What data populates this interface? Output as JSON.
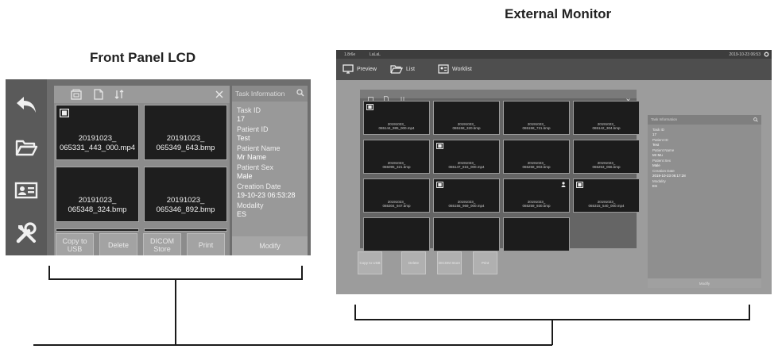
{
  "captions": {
    "front_panel": "Front Panel LCD",
    "external_monitor": "External Monitor"
  },
  "lcd": {
    "sidebar_icons": [
      "back-arrow-icon",
      "folder-icon",
      "contact-card-icon",
      "tools-icon"
    ],
    "toolbar_icons": [
      "image-icon",
      "document-icon",
      "sort-icon",
      "close-icon"
    ],
    "thumbnails": [
      {
        "line1": "20191023_",
        "line2": "065331_443_000.mp4",
        "video": true
      },
      {
        "line1": "20191023_",
        "line2": "065349_643.bmp",
        "video": false
      },
      {
        "line1": "20191023_",
        "line2": "065348_324.bmp",
        "video": false
      },
      {
        "line1": "20191023_",
        "line2": "065346_892.bmp",
        "video": false
      }
    ],
    "buttons": [
      {
        "label": "Copy to USB"
      },
      {
        "label": "Delete"
      },
      {
        "label": "DICOM Store"
      },
      {
        "label": "Print"
      }
    ],
    "info": {
      "header": "Task Information",
      "fields": [
        {
          "key": "Task ID",
          "value": "17"
        },
        {
          "key": "Patient ID",
          "value": "Test"
        },
        {
          "key": "Patient Name",
          "value": "Mr Name"
        },
        {
          "key": "Patient Sex",
          "value": "Male"
        },
        {
          "key": "Creation Date",
          "value": "19-10-23 06:53:28"
        },
        {
          "key": "Modality",
          "value": "ES"
        }
      ],
      "modify_label": "Modify"
    }
  },
  "monitor": {
    "status_left": "1.8r6e",
    "status_left2": "LaLaL",
    "status_right": "2019-10-23 06:53",
    "nav": [
      {
        "label": "Preview",
        "icon": "monitor-icon"
      },
      {
        "label": "List",
        "icon": "folder-icon"
      },
      {
        "label": "Worklist",
        "icon": "contact-card-icon"
      }
    ],
    "thumbnails": [
      {
        "line1": "20191023_",
        "line2": "065144_985_000.mp4",
        "video": true,
        "person": false
      },
      {
        "line1": "20191023_",
        "line2": "065158_320.bmp",
        "video": false,
        "person": false
      },
      {
        "line1": "20191023_",
        "line2": "065158_721.bmp",
        "video": false,
        "person": false
      },
      {
        "line1": "20191023_",
        "line2": "065142_304.bmp",
        "video": false,
        "person": false
      },
      {
        "line1": "20191023_",
        "line2": "065095_321.bmp",
        "video": false,
        "person": false
      },
      {
        "line1": "20191023_",
        "line2": "065147_815_000.mp4",
        "video": true,
        "person": false
      },
      {
        "line1": "20191023_",
        "line2": "065258_903.bmp",
        "video": false,
        "person": false
      },
      {
        "line1": "20191023_",
        "line2": "065253_066.bmp",
        "video": false,
        "person": false
      },
      {
        "line1": "20191023_",
        "line2": "065304_947.bmp",
        "video": false,
        "person": false
      },
      {
        "line1": "20191023_",
        "line2": "065155_969_000.mp4",
        "video": true,
        "person": false
      },
      {
        "line1": "20191023_",
        "line2": "065259_930.bmp",
        "video": false,
        "person": true
      },
      {
        "line1": "20191023_",
        "line2": "065315_540_000.mp4",
        "video": true,
        "person": false
      },
      {
        "line1": "",
        "line2": "",
        "video": false,
        "person": false
      },
      {
        "line1": "",
        "line2": "",
        "video": false,
        "person": false
      },
      {
        "line1": "",
        "line2": "",
        "video": false,
        "person": false
      }
    ],
    "buttons": [
      {
        "label": "Copy to USB"
      },
      {
        "label": "Delete"
      },
      {
        "label": "DICOM Store"
      },
      {
        "label": "Print"
      }
    ],
    "info": {
      "header": "Task Information",
      "fields": [
        {
          "key": "Task ID",
          "value": "17"
        },
        {
          "key": "Patient ID",
          "value": "Test"
        },
        {
          "key": "Patient Name",
          "value": "Mr Mu"
        },
        {
          "key": "Patient Sex",
          "value": "Male"
        },
        {
          "key": "Creation Date",
          "value": "2019-10-23 06:17:28"
        },
        {
          "key": "Modality",
          "value": "ES"
        }
      ],
      "modify_label": "Modify"
    }
  }
}
